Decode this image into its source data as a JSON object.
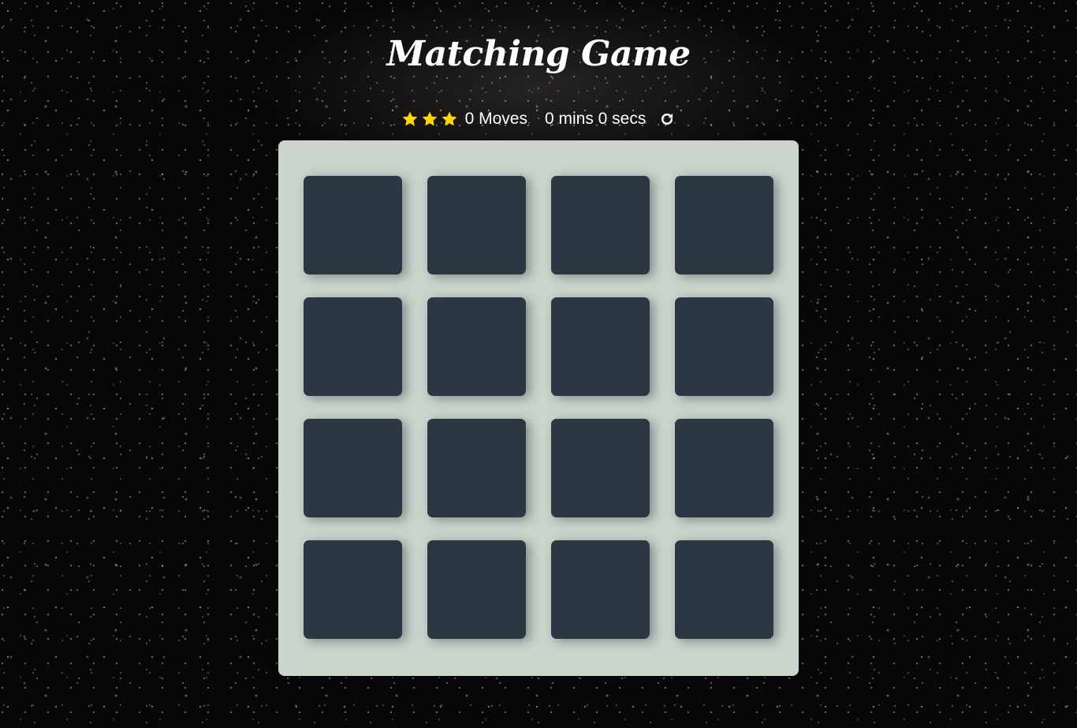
{
  "header": {
    "title": "Matching Game"
  },
  "score_panel": {
    "stars": [
      {
        "icon": "star-icon",
        "filled": true
      },
      {
        "icon": "star-icon",
        "filled": true
      },
      {
        "icon": "star-icon",
        "filled": true
      }
    ],
    "moves_text": "0 Moves",
    "timer_text": "0 mins 0 secs",
    "restart_icon": "restart-icon"
  },
  "deck": {
    "rows": 4,
    "columns": 4,
    "cards_face_down": 16
  },
  "colors": {
    "star": "#ffd700",
    "deck_background": "#ccd5cc",
    "card_back": "#2b3743",
    "text": "#ffffff"
  }
}
